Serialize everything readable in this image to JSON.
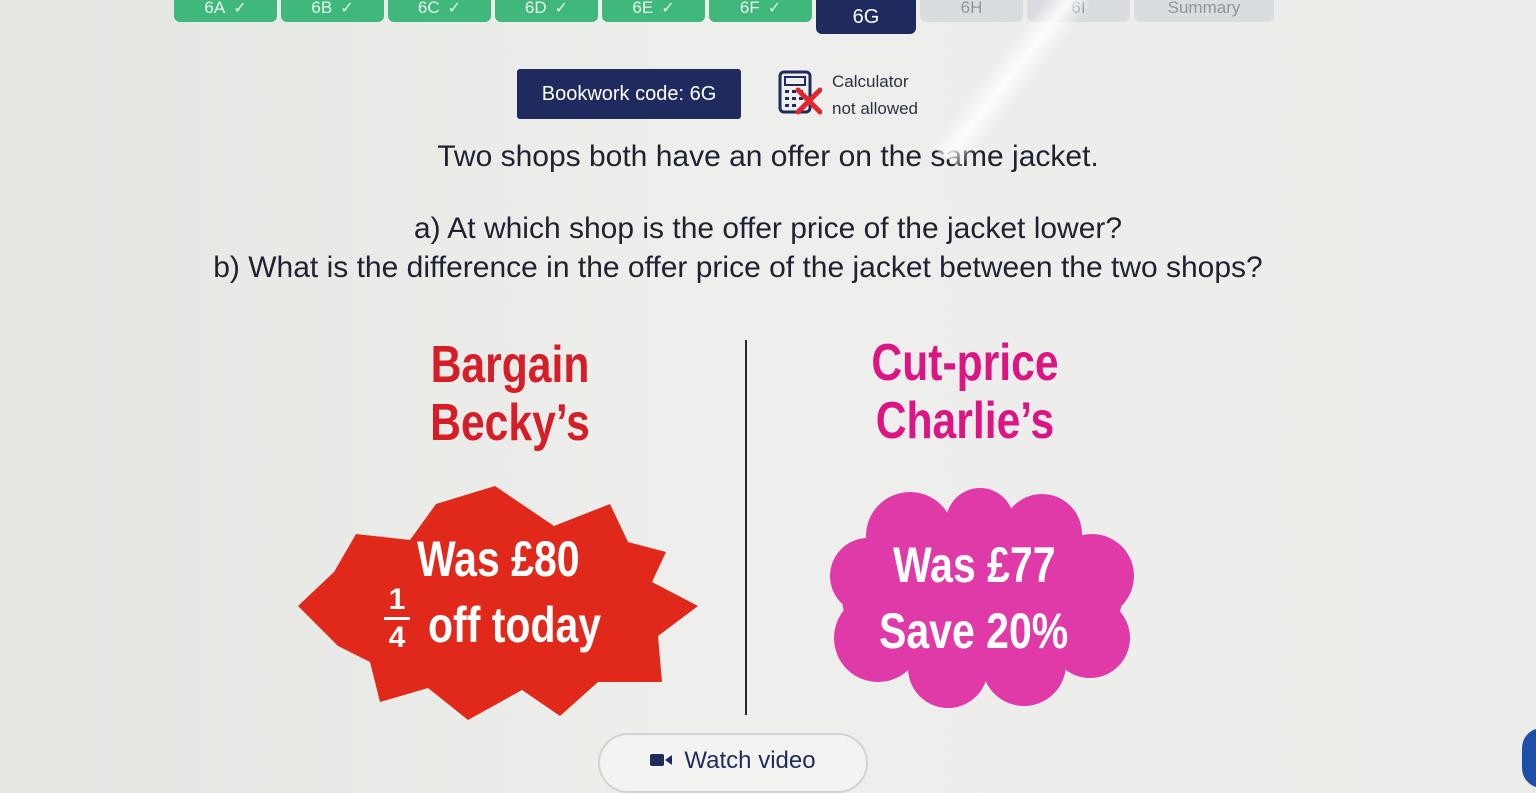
{
  "tabs": [
    {
      "label": "6A",
      "state": "done"
    },
    {
      "label": "6B",
      "state": "done"
    },
    {
      "label": "6C",
      "state": "done"
    },
    {
      "label": "6D",
      "state": "done"
    },
    {
      "label": "6E",
      "state": "done"
    },
    {
      "label": "6F",
      "state": "done"
    },
    {
      "label": "6G",
      "state": "current"
    },
    {
      "label": "6H",
      "state": "todo"
    },
    {
      "label": "6I",
      "state": "todo"
    },
    {
      "label": "Summary",
      "state": "todo"
    }
  ],
  "check_glyph": "✓",
  "bookwork": {
    "label": "Bookwork code: 6G"
  },
  "calculator": {
    "line1": "Calculator",
    "line2": "not allowed"
  },
  "question": {
    "intro": "Two shops both have an offer on the same jacket.",
    "part_a": "a) At which shop is the offer price of the jacket lower?",
    "part_b": "b) What is the difference in the offer price of the jacket between the two shops?"
  },
  "shops": {
    "becky": {
      "name_line1": "Bargain",
      "name_line2": "Becky’s",
      "was": "Was £80",
      "fraction_num": "1",
      "fraction_den": "4",
      "offer": "off today",
      "color": "#e0281b"
    },
    "charlie": {
      "name_line1": "Cut-price",
      "name_line2": "Charlie’s",
      "was": "Was £77",
      "offer": "Save 20%",
      "color": "#e03aa8"
    }
  },
  "watch_video": {
    "label": "Watch video",
    "icon": "video-camera-icon"
  },
  "colors": {
    "navy": "#1f2a5e",
    "green": "#41b87b",
    "red": "#d51e27",
    "pink": "#db1684"
  }
}
